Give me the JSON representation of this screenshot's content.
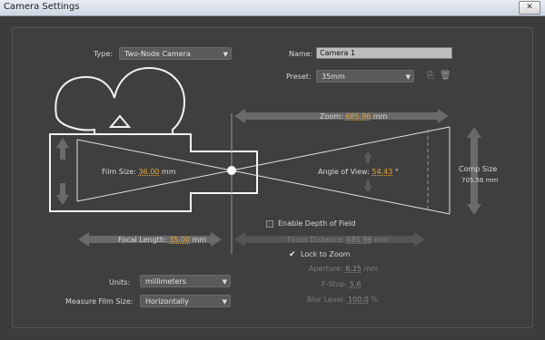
{
  "window": {
    "title": "Camera Settings"
  },
  "form": {
    "type_label": "Type:",
    "type_value": "Two-Node Camera",
    "name_label": "Name:",
    "name_value": "Camera 1",
    "preset_label": "Preset:",
    "preset_value": "35mm"
  },
  "diagram": {
    "zoom_label": "Zoom:",
    "zoom_value": "685.96",
    "zoom_unit": "mm",
    "film_size_label": "Film Size:",
    "film_size_value": "36.00",
    "film_size_unit": "mm",
    "angle_label": "Angle of View:",
    "angle_value": "54.43",
    "angle_unit": "°",
    "comp_size_label": "Comp Size",
    "comp_size_value": "705.56 mm",
    "focal_length_label": "Focal Length:",
    "focal_length_value": "35.00",
    "focal_length_unit": "mm"
  },
  "dof": {
    "enable_label": "Enable Depth of Field",
    "enable_checked": false,
    "focus_distance_label": "Focus Distance:",
    "focus_distance_value": "685.96",
    "focus_distance_unit": "mm",
    "lock_to_zoom_label": "Lock to Zoom",
    "lock_to_zoom_checked": true,
    "aperture_label": "Aperture:",
    "aperture_value": "6.25",
    "aperture_unit": "mm",
    "fstop_label": "F-Stop:",
    "fstop_value": "5.6",
    "blur_label": "Blur Level:",
    "blur_value": "100.0",
    "blur_unit": "%"
  },
  "bottom": {
    "units_label": "Units:",
    "units_value": "millimeters",
    "measure_label": "Measure Film Size:",
    "measure_value": "Horizontally"
  },
  "icons": {
    "close": "close-icon",
    "save_preset": "save-preset-icon",
    "delete_preset": "trash-icon",
    "checkmark": "checkmark-icon"
  },
  "colors": {
    "accent": "#e2a437",
    "background": "#3c3c3c",
    "line": "#ffffff"
  }
}
